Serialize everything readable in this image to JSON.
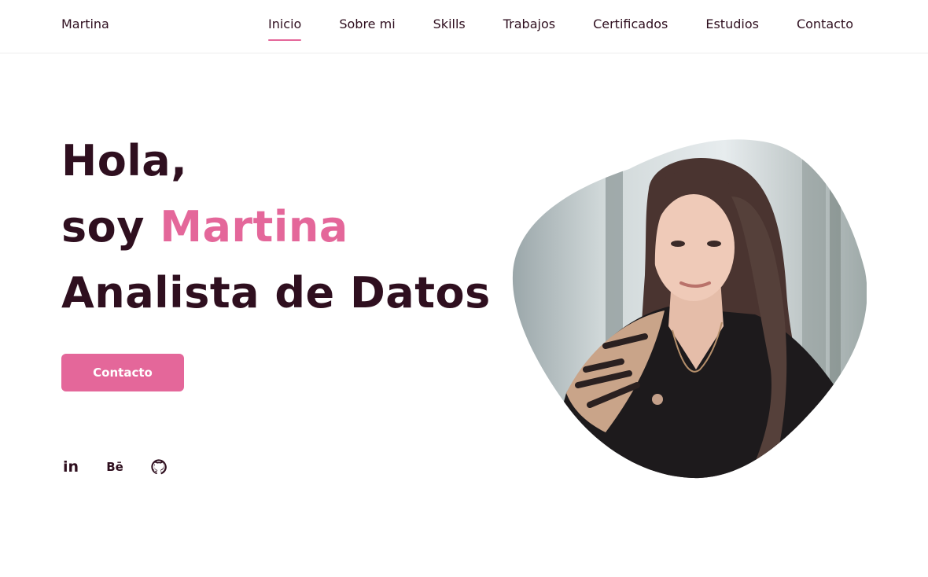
{
  "header": {
    "logo": "Martina",
    "nav": [
      {
        "label": "Inicio",
        "active": true
      },
      {
        "label": "Sobre mi",
        "active": false
      },
      {
        "label": "Skills",
        "active": false
      },
      {
        "label": "Trabajos",
        "active": false
      },
      {
        "label": "Certificados",
        "active": false
      },
      {
        "label": "Estudios",
        "active": false
      },
      {
        "label": "Contacto",
        "active": false
      }
    ]
  },
  "hero": {
    "greeting": "Hola,",
    "intro": "soy ",
    "name": "Martina",
    "role": "Analista de Datos",
    "cta_label": "Contacto"
  },
  "socials": [
    {
      "icon": "linkedin-icon",
      "glyph": "in"
    },
    {
      "icon": "behance-icon",
      "glyph": "Bē"
    },
    {
      "icon": "github-icon",
      "glyph": ""
    }
  ],
  "colors": {
    "accent": "#e4679a",
    "text": "#2f0f1f"
  }
}
